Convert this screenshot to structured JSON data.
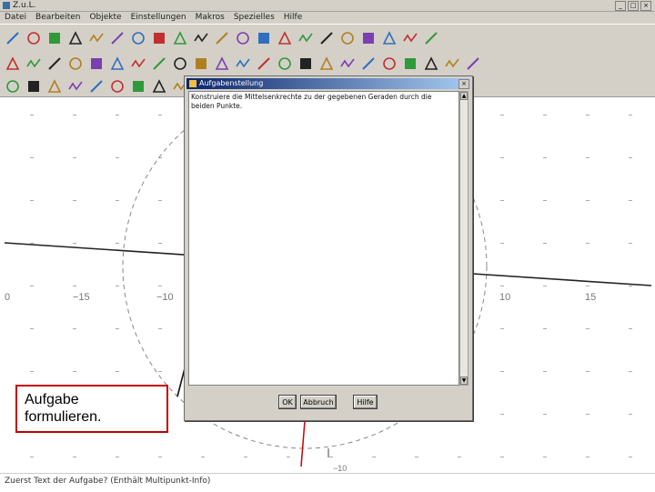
{
  "window": {
    "title": "Z.u.L."
  },
  "menu": [
    "Datei",
    "Bearbeiten",
    "Objekte",
    "Einstellungen",
    "Makros",
    "Spezielles",
    "Hilfe"
  ],
  "toolbar_rows": [
    [
      "new-file-icon",
      "open-file-icon",
      "save-icon",
      "undo-icon",
      "delete-icon",
      "redo-icon",
      "hammer-icon",
      "color-fill-icon",
      "hatch-icon",
      "paste-icon",
      "clipboard-icon",
      "function-icon",
      "arrows-icon",
      "black-square-icon",
      "point-icon",
      "line-style-icon",
      "zoom-icon",
      "angle-icon",
      "magic-icon",
      "palette-icon",
      "info-icon"
    ],
    [
      "point-tool-icon",
      "segment-icon",
      "line-icon",
      "ray-icon",
      "circle-icon",
      "circle3-icon",
      "circle-center-icon",
      "parallel-icon",
      "intersection-icon",
      "perpendicular-icon",
      "midpoint-icon",
      "polygon-icon",
      "angle-tool-icon",
      "bezier-icon",
      "arc-icon",
      "curve-icon",
      "film-icon",
      "equation-icon",
      "quadrilateral-icon",
      "polygon-fill-icon",
      "text-icon",
      "wrench-icon",
      "settings-icon"
    ],
    [
      "point-on-icon",
      "triangle-icon",
      "triangle2-icon",
      "line-tool-icon",
      "diagonal-icon",
      "cross-icon",
      "x-icon",
      "circle-tool-icon",
      "construct-icon"
    ]
  ],
  "graph": {
    "x_tick_labels": [
      "0",
      "−15",
      "−10",
      "10",
      "15"
    ],
    "y_tick_label": "−10"
  },
  "dialog": {
    "title": "Aufgabenstellung",
    "text": "Konstruiere die Mittelsenkrechte zu der gegebenen Geraden durch die beiden Punkte.",
    "ok_label": "OK",
    "cancel_label": "Abbruch",
    "help_label": "Hilfe"
  },
  "callout": {
    "text": "Aufgabe\nformulieren."
  },
  "status": "Zuerst Text der Aufgabe? (Enthält Multipunkt-Info)",
  "colors": {
    "callout_border": "#c00000",
    "axis_red": "#cc0000",
    "circle": "#888888"
  }
}
